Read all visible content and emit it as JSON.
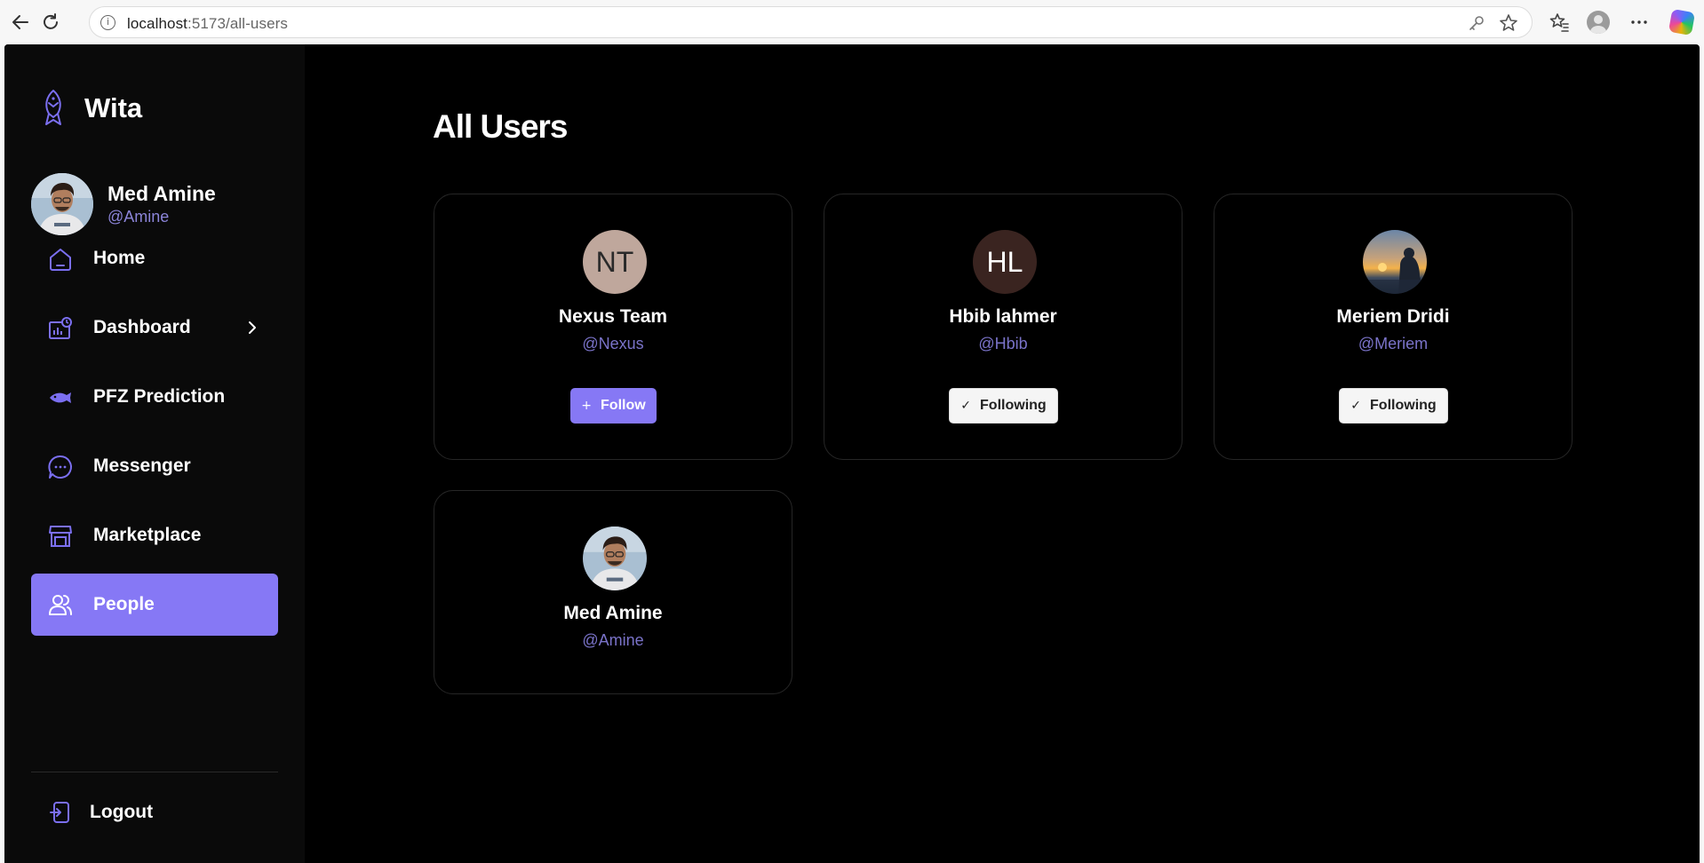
{
  "browser": {
    "url_host": "localhost",
    "url_rest": ":5173/all-users"
  },
  "sidebar": {
    "brand": "Wita",
    "profile": {
      "name": "Med Amine",
      "handle": "@Amine"
    },
    "items": [
      {
        "label": "Home",
        "icon": "home-icon"
      },
      {
        "label": "Dashboard",
        "icon": "dashboard-icon"
      },
      {
        "label": "PFZ Prediction",
        "icon": "fish-icon"
      },
      {
        "label": "Messenger",
        "icon": "chat-icon"
      },
      {
        "label": "Marketplace",
        "icon": "store-icon"
      },
      {
        "label": "People",
        "icon": "people-icon",
        "active": true
      }
    ],
    "logout": "Logout"
  },
  "main": {
    "title": "All Users",
    "users": [
      {
        "initials": "NT",
        "name": "Nexus Team",
        "handle": "@Nexus",
        "avatar_color": "#bfa79c",
        "action": "Follow",
        "action_glyph": "+"
      },
      {
        "initials": "HL",
        "name": "Hbib lahmer",
        "handle": "@Hbib",
        "avatar_color": "#3a2420",
        "action": "Following",
        "action_glyph": "✓"
      },
      {
        "name": "Meriem Dridi",
        "handle": "@Meriem",
        "avatar": "sunset-photo",
        "action": "Following",
        "action_glyph": "✓"
      },
      {
        "name": "Med Amine",
        "handle": "@Amine",
        "avatar": "user-photo"
      }
    ]
  },
  "colors": {
    "accent": "#8678f5",
    "handle": "#7a73c9",
    "background": "#000000"
  }
}
